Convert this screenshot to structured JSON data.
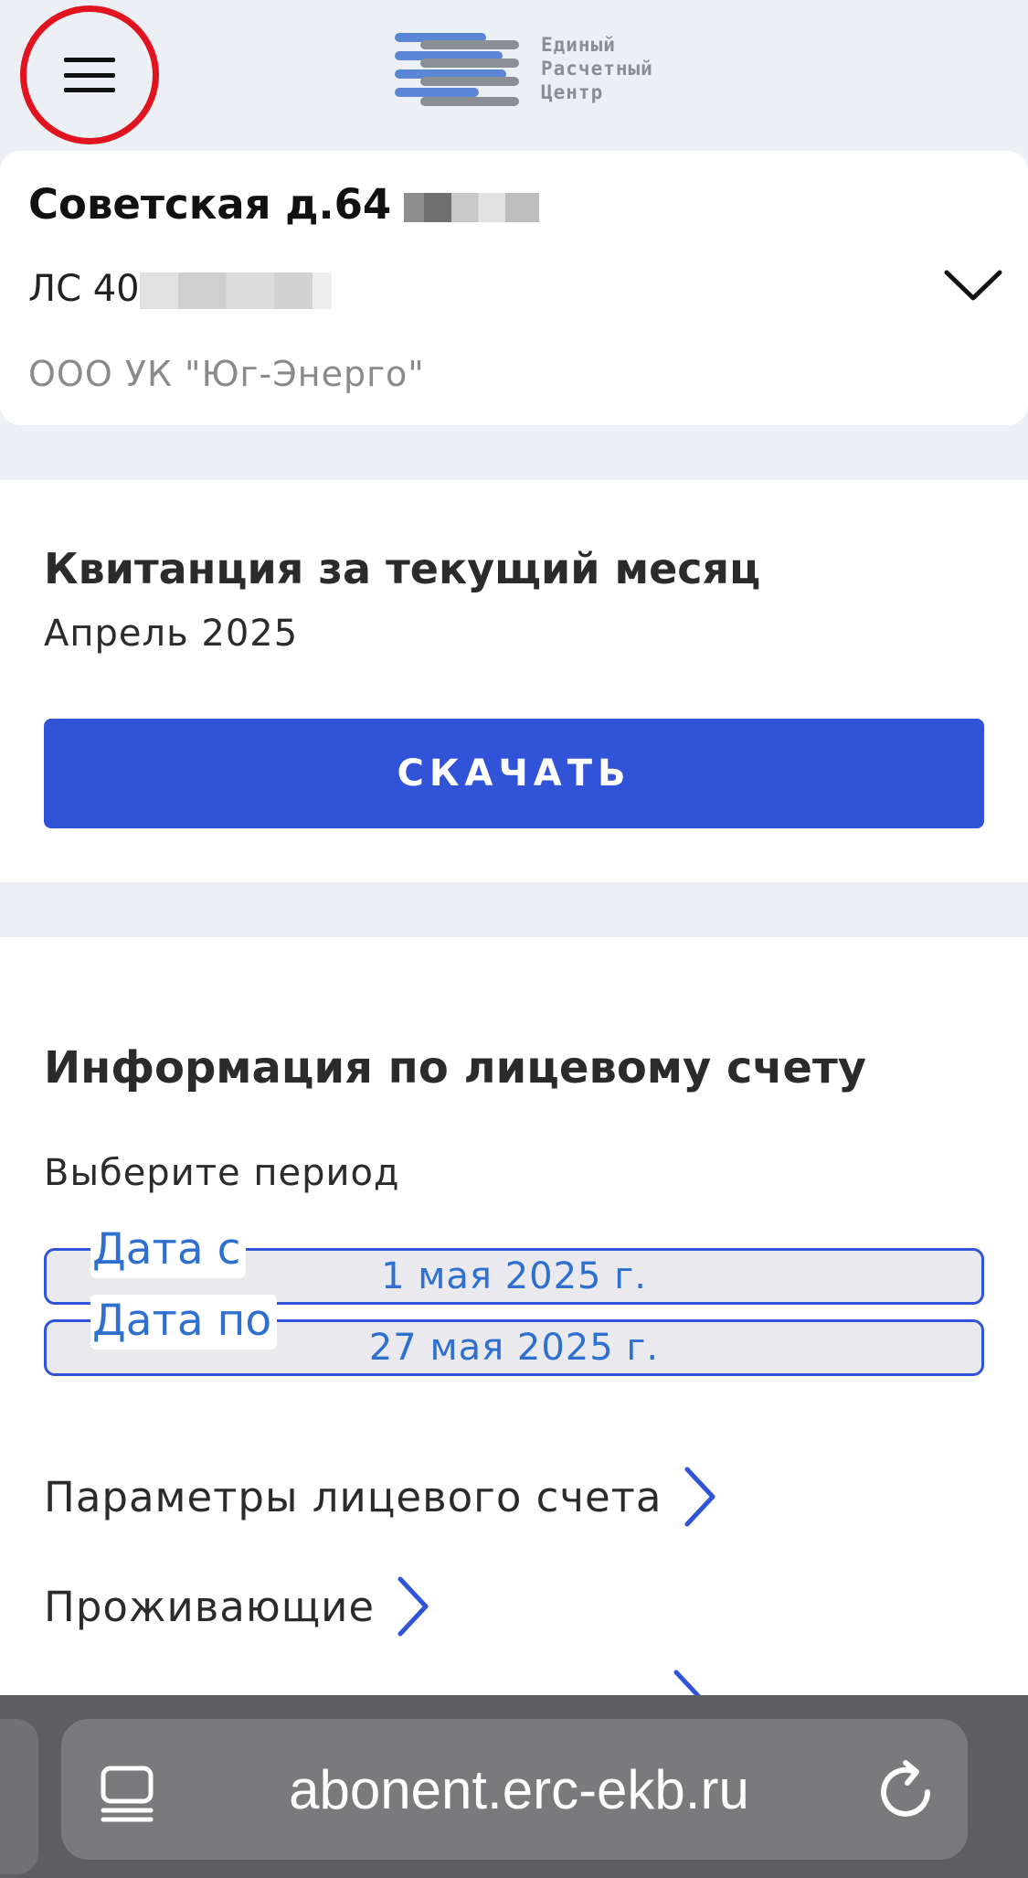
{
  "header": {
    "logo_lines": [
      "Единый",
      "Расчетный",
      "Центр"
    ],
    "logo_colors": {
      "blue": "#5b86d6",
      "gray": "#8b8e93"
    }
  },
  "account": {
    "address": "Советская д.64",
    "account_number_prefix": "ЛС 40",
    "company": "ООО УК \"Юг-Энерго\""
  },
  "receipt": {
    "title": "Квитанция за текущий месяц",
    "period": "Апрель 2025",
    "download_label": "СКАЧАТЬ"
  },
  "info": {
    "title": "Информация по лицевому счету",
    "period_label": "Выберите период",
    "date_from_label": "Дата с",
    "date_from_value": "1 мая 2025 г.",
    "date_to_label": "Дата по",
    "date_to_value": "27 мая 2025 г.",
    "links": [
      {
        "label": "Параметры лицевого счета"
      },
      {
        "label": "Проживающие"
      }
    ]
  },
  "browser": {
    "url": "abonent.erc-ekb.ru"
  },
  "colors": {
    "accent": "#3153d8",
    "date_text": "#2e6fd0",
    "highlight_ring": "#e0141e",
    "page_bg": "#eceff3"
  }
}
